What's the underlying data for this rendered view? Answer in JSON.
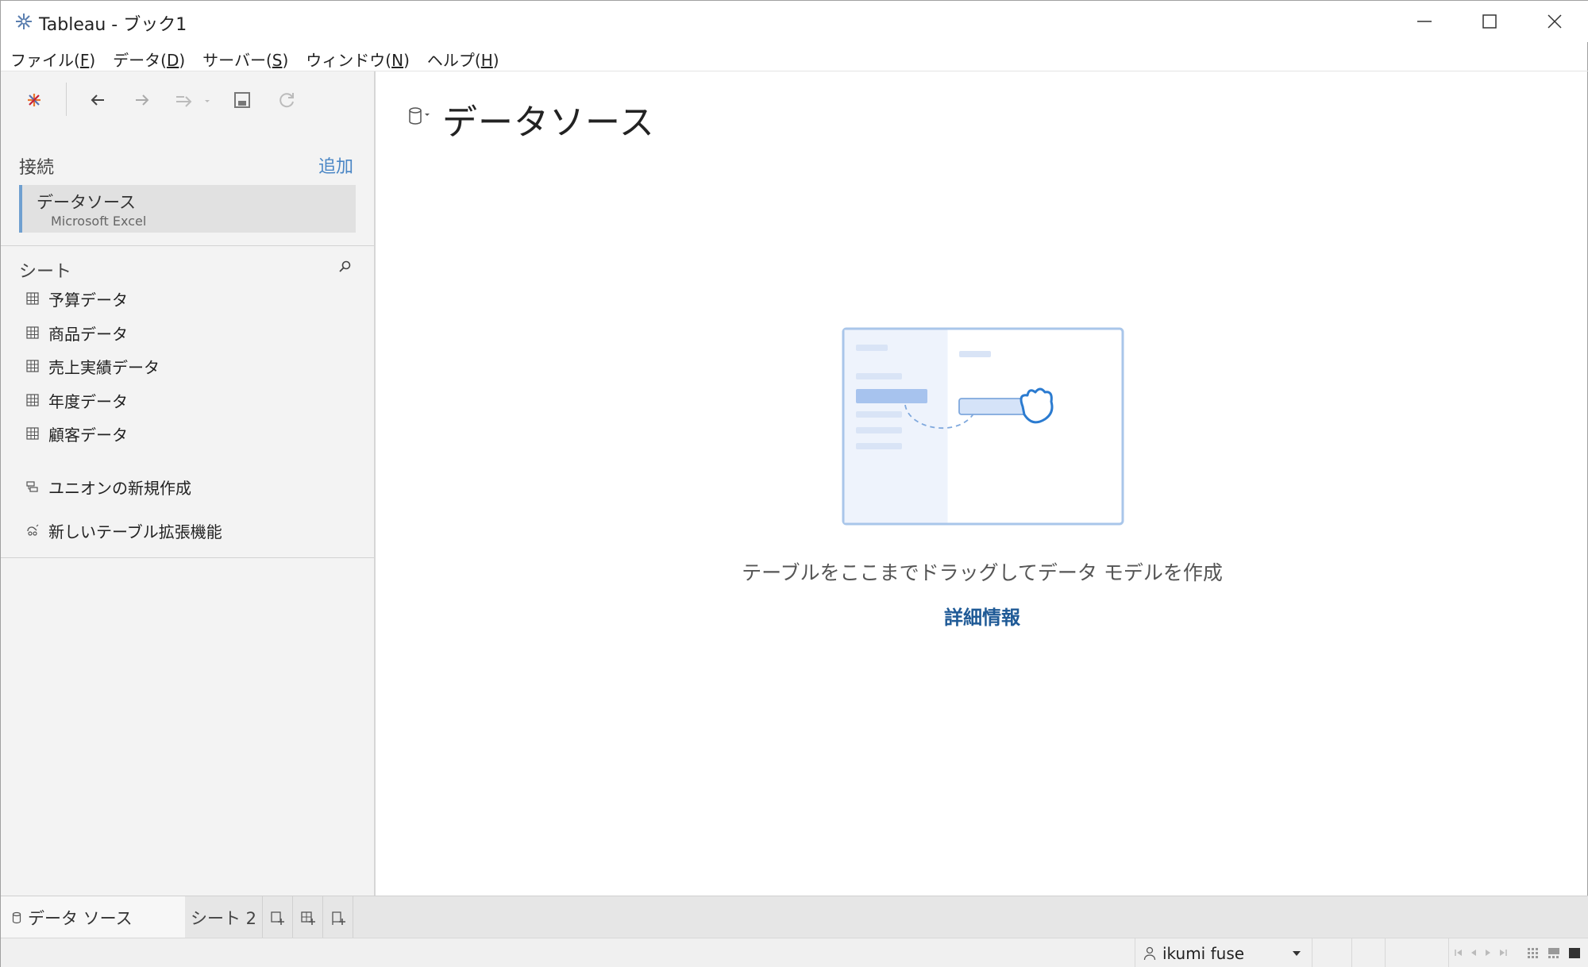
{
  "window": {
    "title": "Tableau - ブック1"
  },
  "menu": {
    "items": [
      {
        "label": "ファイル(",
        "key": "F",
        "end": ")"
      },
      {
        "label": "データ(",
        "key": "D",
        "end": ")"
      },
      {
        "label": "サーバー(",
        "key": "S",
        "end": ")"
      },
      {
        "label": "ウィンドウ(",
        "key": "N",
        "end": ")"
      },
      {
        "label": "ヘルプ(",
        "key": "H",
        "end": ")"
      }
    ]
  },
  "left_panel": {
    "connections_title": "接続",
    "add_label": "追加",
    "connection": {
      "name": "データソース",
      "type": "Microsoft Excel"
    },
    "sheets_title": "シート",
    "sheets": [
      "予算データ",
      "商品データ",
      "売上実績データ",
      "年度データ",
      "顧客データ"
    ],
    "new_union": "ユニオンの新規作成",
    "table_extension": "新しいテーブル拡張機能"
  },
  "main": {
    "title": "データソース",
    "drop_hint": "テーブルをここまでドラッグしてデータ モデルを作成",
    "learn_more": "詳細情報"
  },
  "tabs": {
    "datasource_tab": "データ ソース",
    "sheet_tab": "シート 2"
  },
  "status": {
    "user": "ikumi fuse"
  },
  "colors": {
    "accent": "#4a86c5",
    "link_dark": "#1f5a96",
    "illustration_border": "#a9c6ea",
    "illustration_bar": "#a7c3ee",
    "hand": "#2b7bd0"
  }
}
